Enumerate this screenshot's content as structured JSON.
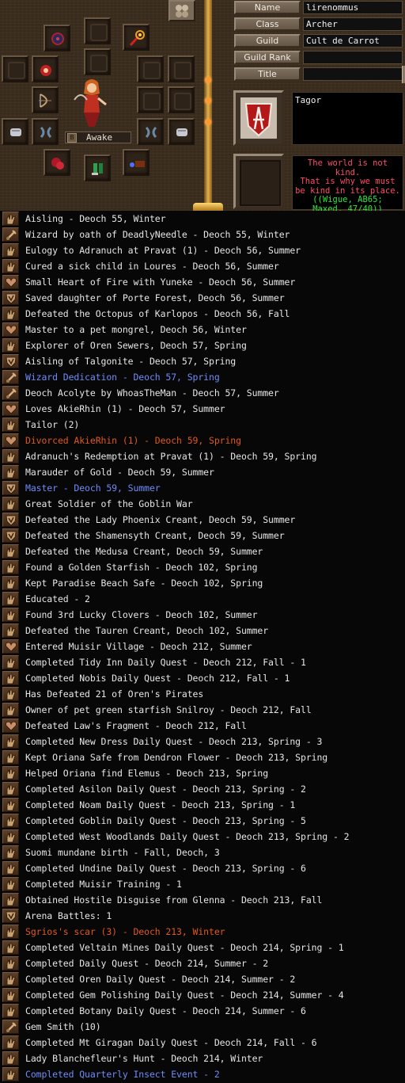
{
  "profile": {
    "status": "Awake",
    "status_badge": "B",
    "labels": {
      "name": "Name",
      "class": "Class",
      "guild": "Guild",
      "guild_rank": "Guild Rank",
      "title": "Title"
    },
    "values": {
      "name": "lirenommus",
      "class": "Archer",
      "guild": "Cult de Carrot",
      "guild_rank": "",
      "title": ""
    },
    "nation": "Tagor",
    "quote_line1": "The world is not kind.\nThat is why we must\nbe kind in its place.",
    "quote_line2": "((Wigue, AB65;\nMaxed, 47/40))"
  },
  "legend_icons": [
    "hand-mark-icon",
    "wizard-mark-icon",
    "heart-mark-icon",
    "shield-mark-icon"
  ],
  "colors": {
    "default_text": "#e6e6e6",
    "blue_text": "#6e8cf8",
    "orange_text": "#e0581c",
    "quote_red": "#ff4a6a",
    "quote_green": "#28e838"
  },
  "legend": [
    {
      "icon": "hand",
      "text": "Aisling - Deoch 55, Winter",
      "color": "default"
    },
    {
      "icon": "wizard",
      "text": "Wizard by oath of DeadlyNeedle - Deoch 55, Winter",
      "color": "default"
    },
    {
      "icon": "hand",
      "text": "Eulogy to Adranuch at Pravat (1) - Deoch 56, Summer",
      "color": "default"
    },
    {
      "icon": "hand",
      "text": "Cured a sick child in Loures - Deoch 56, Summer",
      "color": "default"
    },
    {
      "icon": "heart",
      "text": "Small Heart of Fire with Yuneke - Deoch 56, Summer",
      "color": "default"
    },
    {
      "icon": "shield",
      "text": "Saved daughter of Porte Forest, Deoch 56, Summer",
      "color": "default"
    },
    {
      "icon": "hand",
      "text": "Defeated the Octopus of Karlopos - Deoch 56, Fall",
      "color": "default"
    },
    {
      "icon": "heart",
      "text": "Master to a pet mongrel, Deoch 56, Winter",
      "color": "default"
    },
    {
      "icon": "hand",
      "text": "Explorer of Oren Sewers, Deoch 57, Spring",
      "color": "default"
    },
    {
      "icon": "shield",
      "text": "Aisling of Talgonite - Deoch 57, Spring",
      "color": "default"
    },
    {
      "icon": "wizard",
      "text": "Wizard Dedication - Deoch 57, Spring",
      "color": "blue"
    },
    {
      "icon": "wizard",
      "text": "Deoch Acolyte by WhoasTheMan - Deoch 57, Summer",
      "color": "default"
    },
    {
      "icon": "heart",
      "text": "Loves AkieRhin (1) - Deoch 57, Summer",
      "color": "default"
    },
    {
      "icon": "hand",
      "text": "Tailor (2)",
      "color": "default"
    },
    {
      "icon": "heart",
      "text": "Divorced AkieRhin (1) - Deoch 59, Spring",
      "color": "orange"
    },
    {
      "icon": "hand",
      "text": "Adranuch's Redemption at Pravat (1) - Deoch 59, Spring",
      "color": "default"
    },
    {
      "icon": "hand",
      "text": "Marauder of Gold - Deoch 59, Summer",
      "color": "default"
    },
    {
      "icon": "shield",
      "text": "Master - Deoch 59, Summer",
      "color": "blue"
    },
    {
      "icon": "hand",
      "text": "Great Soldier of the Goblin War",
      "color": "default"
    },
    {
      "icon": "shield",
      "text": "Defeated the Lady Phoenix Creant, Deoch 59, Summer",
      "color": "default"
    },
    {
      "icon": "shield",
      "text": "Defeated the Shamensyth Creant, Deoch 59, Summer",
      "color": "default"
    },
    {
      "icon": "hand",
      "text": "Defeated the Medusa Creant, Deoch 59, Summer",
      "color": "default"
    },
    {
      "icon": "hand",
      "text": "Found a Golden Starfish - Deoch 102, Spring",
      "color": "default"
    },
    {
      "icon": "hand",
      "text": "Kept Paradise Beach Safe - Deoch 102, Spring",
      "color": "default"
    },
    {
      "icon": "hand",
      "text": "Educated - 2",
      "color": "default"
    },
    {
      "icon": "hand",
      "text": "Found 3rd Lucky Clovers - Deoch 102, Summer",
      "color": "default"
    },
    {
      "icon": "hand",
      "text": "Defeated the Tauren Creant, Deoch 102, Summer",
      "color": "default"
    },
    {
      "icon": "heart",
      "text": "Entered Muisir Village - Deoch 212, Summer",
      "color": "default"
    },
    {
      "icon": "hand",
      "text": "Completed Tidy Inn Daily Quest - Deoch 212, Fall - 1",
      "color": "default"
    },
    {
      "icon": "hand",
      "text": "Completed Nobis Daily Quest - Deoch 212, Fall - 1",
      "color": "default"
    },
    {
      "icon": "hand",
      "text": "Has Defeated 21 of Oren's Pirates",
      "color": "default"
    },
    {
      "icon": "hand",
      "text": "Owner of pet green starfish Snilroy - Deoch 212, Fall",
      "color": "default"
    },
    {
      "icon": "heart",
      "text": "Defeated Law's Fragment - Deoch 212, Fall",
      "color": "default"
    },
    {
      "icon": "hand",
      "text": "Completed New Dress Daily Quest - Deoch 213, Spring - 3",
      "color": "default"
    },
    {
      "icon": "hand",
      "text": "Kept Oriana Safe from Dendron Flower - Deoch 213, Spring",
      "color": "default"
    },
    {
      "icon": "hand",
      "text": "Helped Oriana find Elemus - Deoch 213, Spring",
      "color": "default"
    },
    {
      "icon": "hand",
      "text": "Completed Asilon Daily Quest - Deoch 213, Spring - 2",
      "color": "default"
    },
    {
      "icon": "hand",
      "text": "Completed Noam Daily Quest - Deoch 213, Spring - 1",
      "color": "default"
    },
    {
      "icon": "hand",
      "text": "Completed Goblin Daily Quest - Deoch 213, Spring - 5",
      "color": "default"
    },
    {
      "icon": "hand",
      "text": "Completed West Woodlands Daily Quest - Deoch 213, Spring - 2",
      "color": "default"
    },
    {
      "icon": "hand",
      "text": "Suomi mundane birth - Fall, Deoch, 3",
      "color": "default"
    },
    {
      "icon": "hand",
      "text": "Completed Undine Daily Quest - Deoch 213, Spring - 6",
      "color": "default"
    },
    {
      "icon": "hand",
      "text": "Completed Muisir Training - 1",
      "color": "default"
    },
    {
      "icon": "hand",
      "text": "Obtained Hostile Disguise from Glenna - Deoch 213, Fall",
      "color": "default"
    },
    {
      "icon": "shield",
      "text": "Arena Battles: 1",
      "color": "default"
    },
    {
      "icon": "hand",
      "text": "Sgrios's scar (3) - Deoch 213, Winter",
      "color": "orange"
    },
    {
      "icon": "hand",
      "text": "Completed Veltain Mines Daily Quest - Deoch 214, Spring - 1",
      "color": "default"
    },
    {
      "icon": "hand",
      "text": "Completed Daily Quest - Deoch 214, Summer - 2",
      "color": "default"
    },
    {
      "icon": "hand",
      "text": "Completed Oren Daily Quest - Deoch 214, Summer - 2",
      "color": "default"
    },
    {
      "icon": "hand",
      "text": "Completed Gem Polishing Daily Quest - Deoch 214, Summer - 4",
      "color": "default"
    },
    {
      "icon": "hand",
      "text": "Completed Botany Daily Quest - Deoch 214, Summer - 6",
      "color": "default"
    },
    {
      "icon": "wizard",
      "text": "Gem Smith (10)",
      "color": "default"
    },
    {
      "icon": "hand",
      "text": "Completed Mt Giragan Daily Quest - Deoch 214, Fall - 6",
      "color": "default"
    },
    {
      "icon": "hand",
      "text": "Lady Blanchefleur's Hunt - Deoch 214, Winter",
      "color": "default"
    },
    {
      "icon": "hand",
      "text": "Completed Quarterly Insect Event - 2",
      "color": "blue"
    }
  ]
}
